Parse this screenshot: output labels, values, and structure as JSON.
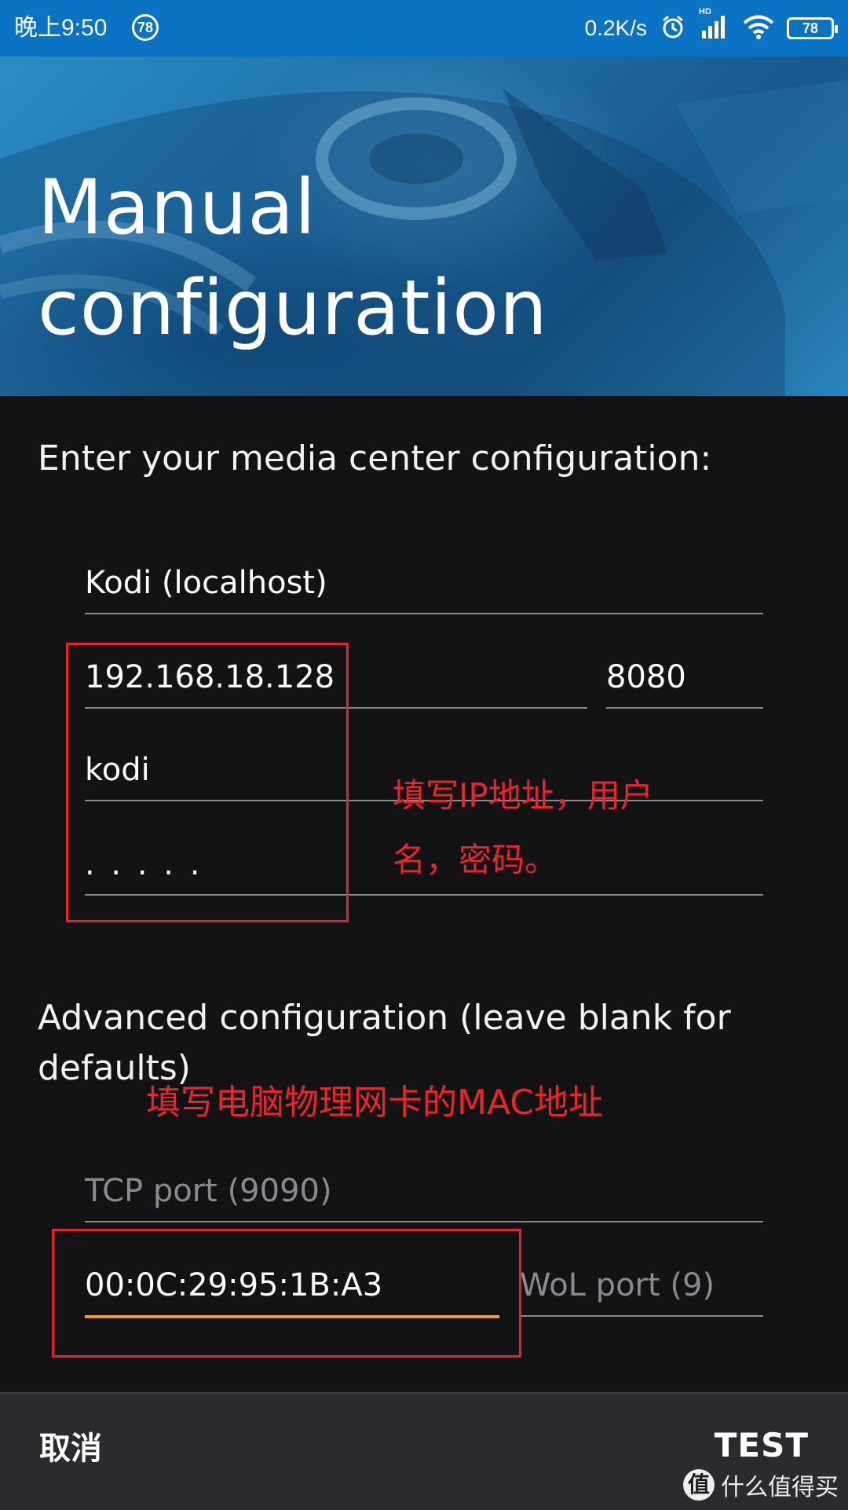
{
  "status_bar": {
    "time": "晚上9:50",
    "notification_badge": "78",
    "network_speed": "0.2K/s",
    "hd_label": "HD",
    "battery": "78",
    "icons": [
      "alarm-icon",
      "signal-icon",
      "wifi-icon",
      "battery-icon"
    ]
  },
  "header": {
    "title_line1": "Manual",
    "title_line2": "configuration"
  },
  "form": {
    "intro": "Enter your media center configuration:",
    "name_value": "Kodi (localhost)",
    "ip_value": "192.168.18.128",
    "port_value": "8080",
    "username_value": "kodi",
    "password_value": ". . . . ."
  },
  "advanced": {
    "title": "Advanced configuration (leave blank for defaults)",
    "tcp_port_placeholder": "TCP port (9090)",
    "mac_value": "00:0C:29:95:1B:A3",
    "wol_port_placeholder": "WoL port (9)"
  },
  "annotations": {
    "note1_line1": "填写IP地址，用户",
    "note1_line2": "名，密码。",
    "note2": "填写电脑物理网卡的MAC地址",
    "color": "#e8262c"
  },
  "actions": {
    "cancel_label": "取消",
    "test_label": "TEST"
  },
  "watermark": {
    "logo_text": "值",
    "text": "什么值得买"
  },
  "colors": {
    "status_bar": "#0a73c4",
    "background": "#131316",
    "active_underline": "#f39c1f",
    "bottom_bar": "#2b2b2f"
  }
}
